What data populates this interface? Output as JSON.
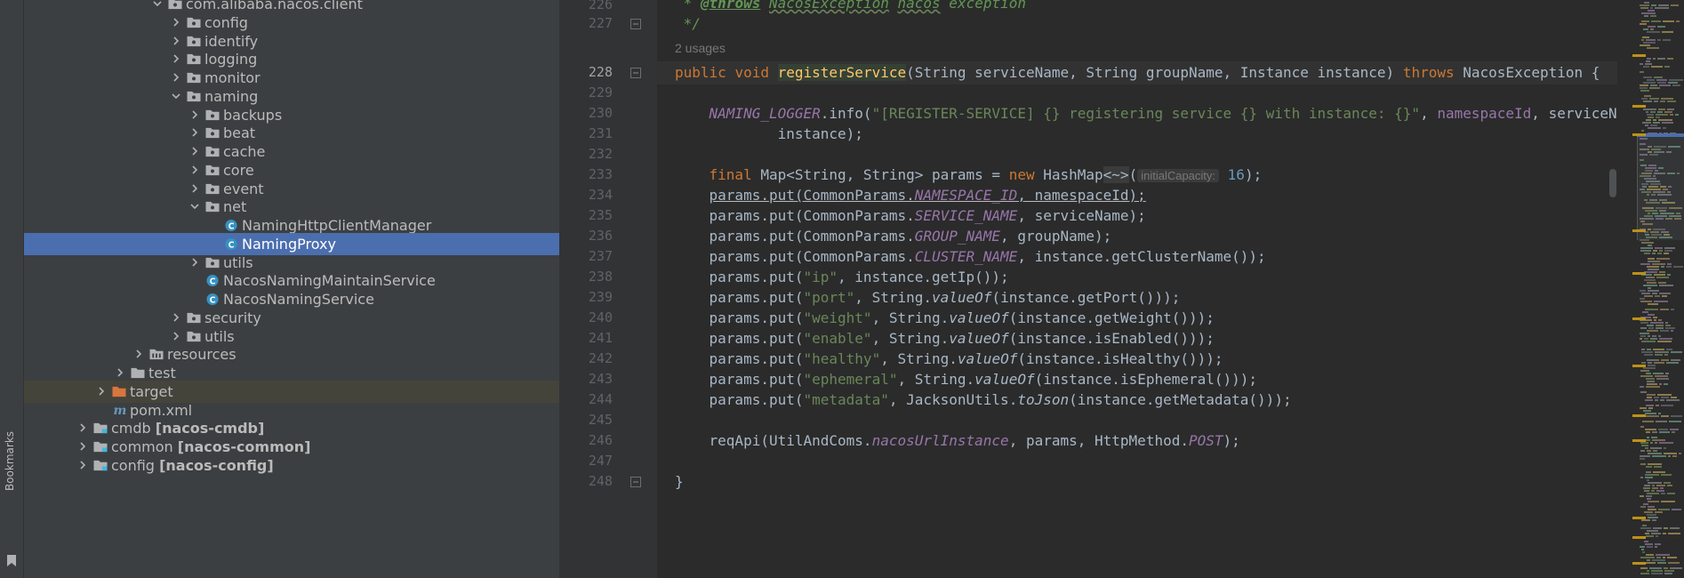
{
  "sidebar": {
    "bookmarks_label": "Bookmarks"
  },
  "project_tree": [
    {
      "label": "com.alibaba.nacos.client",
      "type": "package",
      "level": 0,
      "chevron": "down"
    },
    {
      "label": "config",
      "type": "package",
      "level": 1,
      "chevron": "right"
    },
    {
      "label": "identify",
      "type": "package",
      "level": 1,
      "chevron": "right"
    },
    {
      "label": "logging",
      "type": "package",
      "level": 1,
      "chevron": "right"
    },
    {
      "label": "monitor",
      "type": "package",
      "level": 1,
      "chevron": "right"
    },
    {
      "label": "naming",
      "type": "package",
      "level": 1,
      "chevron": "down"
    },
    {
      "label": "backups",
      "type": "package",
      "level": 2,
      "chevron": "right"
    },
    {
      "label": "beat",
      "type": "package",
      "level": 2,
      "chevron": "right"
    },
    {
      "label": "cache",
      "type": "package",
      "level": 2,
      "chevron": "right"
    },
    {
      "label": "core",
      "type": "package",
      "level": 2,
      "chevron": "right"
    },
    {
      "label": "event",
      "type": "package",
      "level": 2,
      "chevron": "right"
    },
    {
      "label": "net",
      "type": "package",
      "level": 2,
      "chevron": "down"
    },
    {
      "label": "NamingHttpClientManager",
      "type": "class",
      "level": 3,
      "chevron": "none"
    },
    {
      "label": "NamingProxy",
      "type": "class",
      "level": 3,
      "chevron": "none",
      "selected": true
    },
    {
      "label": "utils",
      "type": "package",
      "level": 2,
      "chevron": "right"
    },
    {
      "label": "NacosNamingMaintainService",
      "type": "class",
      "level": 2,
      "chevron": "none"
    },
    {
      "label": "NacosNamingService",
      "type": "class",
      "level": 2,
      "chevron": "none"
    },
    {
      "label": "security",
      "type": "package",
      "level": 1,
      "chevron": "right"
    },
    {
      "label": "utils",
      "type": "package",
      "level": 1,
      "chevron": "right"
    },
    {
      "label": "resources",
      "type": "resources",
      "level": -1,
      "chevron": "right"
    },
    {
      "label": "test",
      "type": "folder",
      "level": -2,
      "chevron": "right"
    },
    {
      "label": "target",
      "type": "target",
      "level": -3,
      "chevron": "right",
      "highlight": true
    },
    {
      "label": "pom.xml",
      "type": "maven",
      "level": -3,
      "chevron": "none"
    },
    {
      "label": "cmdb",
      "module": "[nacos-cmdb]",
      "type": "module",
      "level": -4,
      "chevron": "right"
    },
    {
      "label": "common",
      "module": "[nacos-common]",
      "type": "module",
      "level": -4,
      "chevron": "right"
    },
    {
      "label": "config",
      "module": "[nacos-config]",
      "type": "module",
      "level": -4,
      "chevron": "right"
    }
  ],
  "editor": {
    "usages_hint": "2 usages",
    "inlay_hint": "initialCapacity:",
    "line_numbers": [
      "226",
      "227",
      "",
      "228",
      "229",
      "230",
      "231",
      "232",
      "233",
      "234",
      "235",
      "236",
      "237",
      "238",
      "239",
      "240",
      "241",
      "242",
      "243",
      "244",
      "245",
      "246",
      "247",
      "248"
    ],
    "code": {
      "doc_tag": "@throws",
      "doc_exc": "NacosException",
      "doc_word": "nacos",
      "doc_rest": "exception",
      "doc_end": "*/",
      "sig_public": "public",
      "sig_void": "void",
      "sig_name": "registerService",
      "sig_params": "(String serviceName, String groupName, Instance instance)",
      "sig_throws": "throws",
      "sig_exc": "NacosException {",
      "l230_logger": "NAMING_LOGGER",
      "l230_call": ".info(",
      "l230_str": "\"[REGISTER-SERVICE] {} registering service {} with instance: {}\"",
      "l230_comma": ", ",
      "l230_ns": "namespaceId",
      "l230_rest": ", serviceName,",
      "l231": "instance);",
      "l233_final": "final",
      "l233_type": " Map<String, String> params = ",
      "l233_new": "new",
      "l233_cls": " HashMap",
      "l233_diamond": "<~>",
      "l233_paren": "(",
      "l233_num": "16",
      "l233_end": ");",
      "puts": [
        {
          "pre": "params.put(CommonParams.",
          "const": "NAMESPACE_ID",
          "post": ", namespaceId);"
        },
        {
          "pre": "params.put(CommonParams.",
          "const": "SERVICE_NAME",
          "post": ", serviceName);"
        },
        {
          "pre": "params.put(CommonParams.",
          "const": "GROUP_NAME",
          "post": ", groupName);"
        },
        {
          "pre": "params.put(CommonParams.",
          "const": "CLUSTER_NAME",
          "post": ", instance.getClusterName());"
        }
      ],
      "sputs": [
        {
          "key": "\"ip\"",
          "mid": ", instance.getIp());",
          "util": "",
          "fn": ""
        },
        {
          "key": "\"port\"",
          "util": ", String.",
          "fn": "valueOf",
          "mid": "(instance.getPort()));"
        },
        {
          "key": "\"weight\"",
          "util": ", String.",
          "fn": "valueOf",
          "mid": "(instance.getWeight()));"
        },
        {
          "key": "\"enable\"",
          "util": ", String.",
          "fn": "valueOf",
          "mid": "(instance.isEnabled()));"
        },
        {
          "key": "\"healthy\"",
          "util": ", String.",
          "fn": "valueOf",
          "mid": "(instance.isHealthy()));"
        },
        {
          "key": "\"ephemeral\"",
          "util": ", String.",
          "fn": "valueOf",
          "mid": "(instance.isEphemeral()));"
        },
        {
          "key": "\"metadata\"",
          "util": ", JacksonUtils.",
          "fn": "toJson",
          "mid": "(instance.getMetadata()));"
        }
      ],
      "put_prefix": "params.put(",
      "l246_pre": "reqApi(UtilAndComs.",
      "l246_field": "nacosUrlInstance",
      "l246_mid": ", params, HttpMethod.",
      "l246_const": "POST",
      "l246_end": ");",
      "l248": "}"
    }
  },
  "colors": {
    "tree_bg": "#3c3f41",
    "editor_bg": "#2b2b2b",
    "selection": "#4b6eaf",
    "keyword": "#cc7832",
    "string": "#6a8759",
    "function": "#ffc66d",
    "constant": "#9876aa",
    "number": "#6897bb"
  }
}
